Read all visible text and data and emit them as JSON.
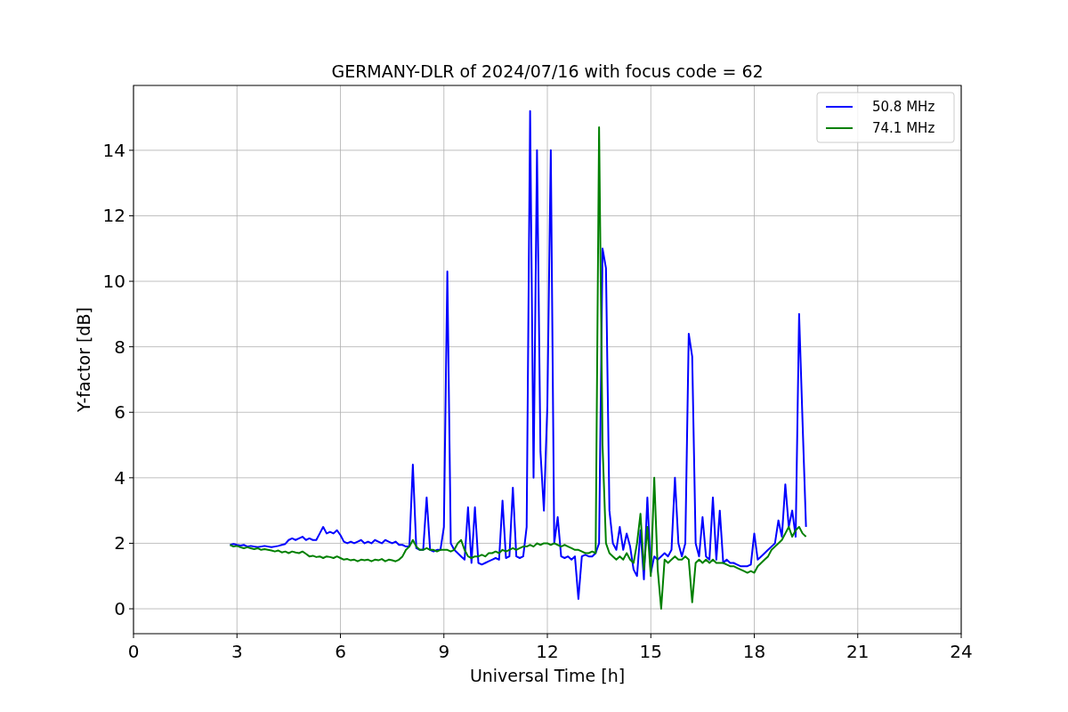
{
  "chart_data": {
    "type": "line",
    "title": "GERMANY-DLR of 2024/07/16 with focus code = 62",
    "xlabel": "Universal Time [h]",
    "ylabel": "Y-factor [dB]",
    "xlim": [
      0,
      24
    ],
    "ylim": [
      -0.76,
      15.98
    ],
    "xticks": [
      0,
      3,
      6,
      9,
      12,
      15,
      18,
      21,
      24
    ],
    "yticks": [
      0,
      2,
      4,
      6,
      8,
      10,
      12,
      14
    ],
    "grid": true,
    "legend": true,
    "x": [
      2.8,
      2.9,
      3.0,
      3.1,
      3.2,
      3.3,
      3.4,
      3.5,
      3.6,
      3.7,
      3.8,
      3.9,
      4.0,
      4.1,
      4.2,
      4.3,
      4.4,
      4.5,
      4.6,
      4.7,
      4.8,
      4.9,
      5.0,
      5.1,
      5.2,
      5.3,
      5.4,
      5.5,
      5.6,
      5.7,
      5.8,
      5.9,
      6.0,
      6.1,
      6.2,
      6.3,
      6.4,
      6.5,
      6.6,
      6.7,
      6.8,
      6.9,
      7.0,
      7.1,
      7.2,
      7.3,
      7.4,
      7.5,
      7.6,
      7.7,
      7.8,
      7.9,
      8.0,
      8.1,
      8.2,
      8.3,
      8.4,
      8.5,
      8.6,
      8.7,
      8.8,
      8.9,
      9.0,
      9.1,
      9.2,
      9.3,
      9.4,
      9.5,
      9.6,
      9.7,
      9.8,
      9.9,
      10.0,
      10.1,
      10.2,
      10.3,
      10.4,
      10.5,
      10.6,
      10.7,
      10.8,
      10.9,
      11.0,
      11.1,
      11.2,
      11.3,
      11.4,
      11.5,
      11.6,
      11.7,
      11.8,
      11.9,
      12.0,
      12.1,
      12.2,
      12.3,
      12.4,
      12.5,
      12.6,
      12.7,
      12.8,
      12.9,
      13.0,
      13.1,
      13.2,
      13.3,
      13.4,
      13.5,
      13.6,
      13.7,
      13.8,
      13.9,
      14.0,
      14.1,
      14.2,
      14.3,
      14.4,
      14.5,
      14.6,
      14.7,
      14.8,
      14.9,
      15.0,
      15.1,
      15.2,
      15.3,
      15.4,
      15.5,
      15.6,
      15.7,
      15.8,
      15.9,
      16.0,
      16.1,
      16.2,
      16.3,
      16.4,
      16.5,
      16.6,
      16.7,
      16.8,
      16.9,
      17.0,
      17.1,
      17.2,
      17.3,
      17.4,
      17.5,
      17.6,
      17.7,
      17.8,
      17.9,
      18.0,
      18.1,
      18.2,
      18.3,
      18.4,
      18.5,
      18.6,
      18.7,
      18.8,
      18.9,
      19.0,
      19.1,
      19.2,
      19.3,
      19.4,
      19.5
    ],
    "series": [
      {
        "name": "50.8 MHz",
        "color": "#0000ff",
        "values": [
          1.95,
          1.98,
          1.95,
          1.93,
          1.95,
          1.9,
          1.92,
          1.9,
          1.88,
          1.9,
          1.92,
          1.9,
          1.88,
          1.9,
          1.92,
          1.95,
          1.98,
          2.1,
          2.15,
          2.1,
          2.15,
          2.2,
          2.1,
          2.15,
          2.1,
          2.1,
          2.3,
          2.5,
          2.3,
          2.35,
          2.3,
          2.4,
          2.25,
          2.05,
          2.0,
          2.05,
          2.0,
          2.05,
          2.1,
          2.0,
          2.05,
          2.0,
          2.1,
          2.05,
          2.0,
          2.1,
          2.05,
          2.0,
          2.05,
          1.95,
          1.95,
          1.9,
          1.9,
          4.4,
          1.85,
          1.8,
          1.8,
          3.4,
          1.8,
          1.75,
          1.8,
          1.8,
          2.5,
          10.3,
          2.0,
          1.8,
          1.7,
          1.6,
          1.5,
          3.1,
          1.4,
          3.1,
          1.4,
          1.35,
          1.4,
          1.45,
          1.5,
          1.55,
          1.5,
          3.3,
          1.55,
          1.6,
          3.7,
          1.6,
          1.55,
          1.6,
          2.5,
          15.2,
          4.0,
          14.0,
          4.8,
          3.0,
          6.2,
          14.0,
          2.0,
          2.8,
          1.6,
          1.55,
          1.6,
          1.5,
          1.6,
          0.3,
          1.6,
          1.65,
          1.6,
          1.6,
          1.7,
          2.0,
          11.0,
          10.4,
          3.0,
          2.0,
          1.8,
          2.5,
          1.8,
          2.3,
          1.9,
          1.2,
          1.0,
          2.4,
          0.9,
          3.4,
          1.1,
          1.6,
          1.5,
          1.6,
          1.7,
          1.6,
          1.8,
          4.0,
          2.0,
          1.6,
          2.0,
          8.4,
          7.7,
          2.0,
          1.6,
          2.8,
          1.6,
          1.5,
          3.4,
          1.5,
          3.0,
          1.4,
          1.5,
          1.4,
          1.4,
          1.35,
          1.3,
          1.3,
          1.3,
          1.35,
          2.3,
          1.5,
          1.6,
          1.7,
          1.8,
          1.9,
          2.0,
          2.7,
          2.2,
          3.8,
          2.5,
          3.0,
          2.2,
          9.0,
          5.7,
          2.5
        ]
      },
      {
        "name": "74.1 MHz",
        "color": "#008000",
        "values": [
          1.95,
          1.9,
          1.92,
          1.88,
          1.85,
          1.88,
          1.85,
          1.82,
          1.85,
          1.8,
          1.82,
          1.8,
          1.78,
          1.75,
          1.78,
          1.72,
          1.75,
          1.7,
          1.75,
          1.72,
          1.7,
          1.75,
          1.68,
          1.6,
          1.62,
          1.58,
          1.6,
          1.55,
          1.6,
          1.58,
          1.55,
          1.6,
          1.55,
          1.5,
          1.52,
          1.48,
          1.5,
          1.45,
          1.5,
          1.48,
          1.5,
          1.45,
          1.5,
          1.48,
          1.52,
          1.45,
          1.5,
          1.48,
          1.45,
          1.5,
          1.6,
          1.8,
          1.9,
          2.1,
          1.9,
          1.8,
          1.8,
          1.85,
          1.8,
          1.8,
          1.75,
          1.8,
          1.8,
          1.8,
          1.75,
          1.8,
          2.0,
          2.1,
          1.8,
          1.6,
          1.55,
          1.6,
          1.6,
          1.65,
          1.6,
          1.7,
          1.7,
          1.75,
          1.7,
          1.8,
          1.75,
          1.8,
          1.85,
          1.8,
          1.85,
          1.9,
          1.9,
          1.95,
          1.9,
          2.0,
          1.95,
          2.0,
          2.0,
          1.95,
          2.0,
          1.95,
          1.9,
          1.95,
          1.9,
          1.85,
          1.8,
          1.8,
          1.75,
          1.7,
          1.7,
          1.75,
          1.7,
          14.7,
          5.0,
          2.0,
          1.7,
          1.6,
          1.5,
          1.6,
          1.5,
          1.7,
          1.5,
          1.4,
          2.0,
          2.9,
          1.2,
          2.5,
          1.0,
          4.0,
          1.2,
          0.0,
          1.5,
          1.4,
          1.5,
          1.6,
          1.5,
          1.5,
          1.6,
          1.5,
          0.2,
          1.4,
          1.5,
          1.4,
          1.5,
          1.4,
          1.5,
          1.4,
          1.4,
          1.4,
          1.35,
          1.3,
          1.3,
          1.25,
          1.2,
          1.15,
          1.1,
          1.15,
          1.1,
          1.3,
          1.4,
          1.5,
          1.6,
          1.8,
          1.9,
          2.0,
          2.1,
          2.3,
          2.5,
          2.2,
          2.4,
          2.5,
          2.3,
          2.2
        ]
      }
    ]
  }
}
